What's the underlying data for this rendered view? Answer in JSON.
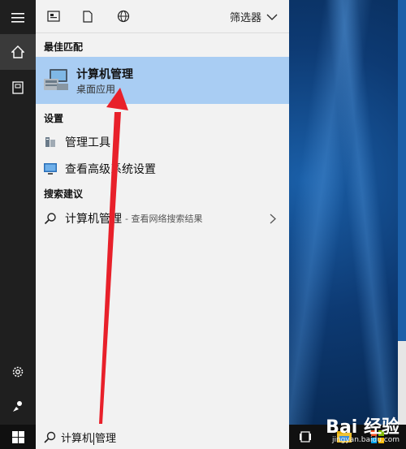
{
  "panel": {
    "filter_label": "筛选器",
    "sections": {
      "best_match": "最佳匹配",
      "settings": "设置",
      "search_suggest": "搜索建议"
    },
    "best_result": {
      "title": "计算机管理",
      "subtitle": "桌面应用"
    },
    "settings_items": [
      {
        "label": "管理工具",
        "icon": "tools-icon"
      },
      {
        "label": "查看高级系统设置",
        "icon": "monitor-settings-icon"
      }
    ],
    "suggestion": {
      "label": "计算机管理",
      "detail": "- 查看网络搜索结果"
    }
  },
  "taskbar": {
    "search_text": "计算机管理",
    "search_text_before_caret": "计算机",
    "search_text_after_caret": "管理"
  },
  "watermark": {
    "logo": "Bai  经验",
    "url": "jingyan.baidu.com"
  },
  "colors": {
    "highlight": "#a9cdf3",
    "arrow": "#e8202a",
    "panel_bg": "#f2f2f2",
    "rail_bg": "#1f1f1f"
  }
}
